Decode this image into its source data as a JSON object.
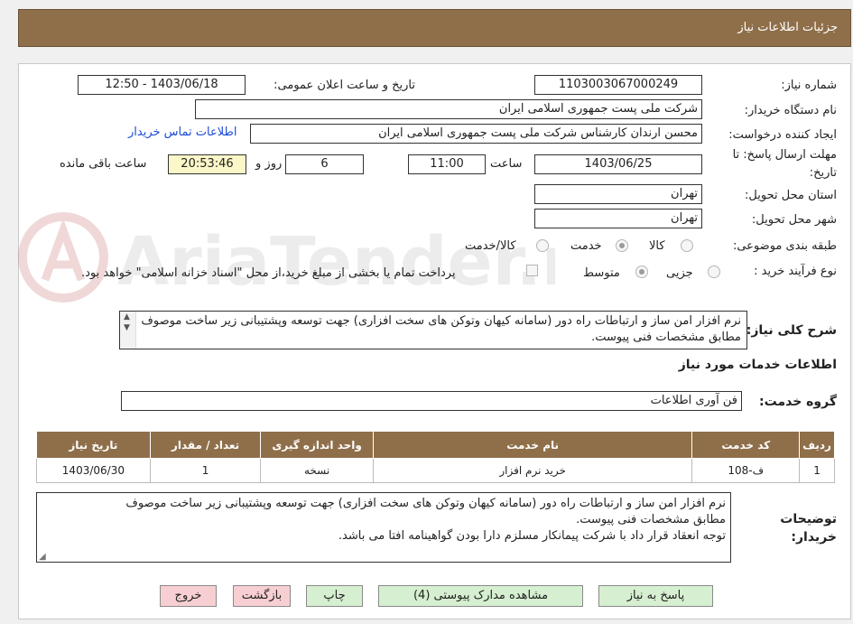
{
  "header": {
    "title": "جزئیات اطلاعات نیاز"
  },
  "fields": {
    "need_number_label": "شماره نیاز:",
    "need_number": "1103003067000249",
    "announce_label": "تاریخ و ساعت اعلان عمومی:",
    "announce_value": "1403/06/18 - 12:50",
    "buyer_org_label": "نام دستگاه خریدار:",
    "buyer_org": "شرکت ملی پست جمهوری اسلامی ایران",
    "requester_label": "ایجاد کننده درخواست:",
    "requester": "محسن ارندان کارشناس شرکت ملی پست جمهوری اسلامی ایران",
    "contact_link": "اطلاعات تماس خریدار",
    "deadline_label_1": "مهلت ارسال پاسخ: تا",
    "deadline_label_2": "تاریخ:",
    "deadline_date": "1403/06/25",
    "time_label": "ساعت",
    "deadline_time": "11:00",
    "days_value": "6",
    "days_label": "روز و",
    "remaining_time": "20:53:46",
    "remaining_label": "ساعت باقی مانده",
    "province_label": "استان محل تحویل:",
    "province": "تهران",
    "city_label": "شهر محل تحویل:",
    "city": "تهران",
    "category_label": "طبقه بندی موضوعی:",
    "category_options": [
      "کالا",
      "خدمت",
      "کالا/خدمت"
    ],
    "category_selected": "خدمت",
    "process_label": "نوع فرآیند خرید :",
    "process_options": [
      "جزیی",
      "متوسط"
    ],
    "process_selected": "متوسط",
    "payment_note": "پرداخت تمام یا بخشی از مبلغ خرید،از محل \"اسناد خزانه اسلامی\" خواهد بود."
  },
  "description": {
    "label": "شرح کلی نیاز:",
    "text": "نرم افزار امن ساز و ارتباطات راه دور (سامانه کیهان وتوکن های سخت افزاری) جهت توسعه وپشتیبانی زیر ساخت موصوف مطابق مشخصات فنی پیوست."
  },
  "services": {
    "section_title": "اطلاعات خدمات مورد نیاز",
    "group_label": "گروه خدمت:",
    "group_value": "فن آوری اطلاعات",
    "columns": [
      "ردیف",
      "کد خدمت",
      "نام خدمت",
      "واحد اندازه گیری",
      "تعداد / مقدار",
      "تاریخ نیاز"
    ],
    "rows": [
      [
        "1",
        "ف-108",
        "خرید نرم افزار",
        "نسخه",
        "1",
        "1403/06/30"
      ]
    ]
  },
  "buyer_notes": {
    "label_1": "توضیحات",
    "label_2": "خریدار:",
    "line1": "نرم افزار امن ساز و ارتباطات راه دور (سامانه کیهان وتوکن های سخت افزاری) جهت توسعه وپشتیبانی زیر ساخت موصوف",
    "line2": "مطابق مشخصات فنی پیوست.",
    "line3": "توجه انعقاد قرار داد با شرکت پیمانکار مسلزم دارا بودن گواهینامه افتا می باشد."
  },
  "buttons": {
    "reply": "پاسخ به نیاز",
    "attachments": "مشاهده مدارک پیوستی (4)",
    "print": "چاپ",
    "back": "بازگشت",
    "exit": "خروج"
  },
  "watermark_text": "AriaTender.neT",
  "colors": {
    "header_bg": "#8f6f4a",
    "green_button": "#d6efd0",
    "pink_button": "#f7cfd2",
    "link": "#1a4bd8"
  }
}
